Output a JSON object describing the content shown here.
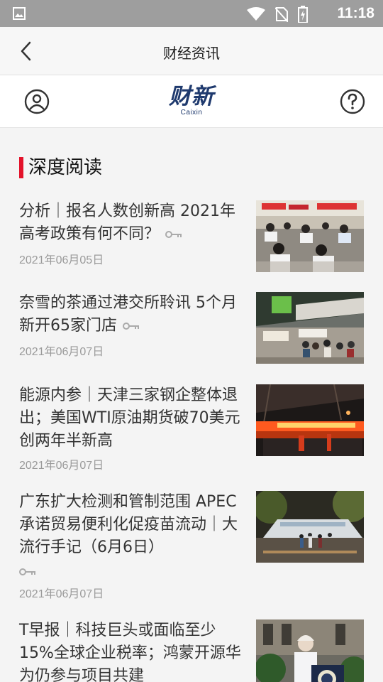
{
  "status_bar": {
    "time": "11:18"
  },
  "title_bar": {
    "title": "财经资讯"
  },
  "brand": {
    "logo_cn": "财新",
    "logo_en": "Caixin"
  },
  "section": {
    "title": "深度阅读"
  },
  "articles": [
    {
      "headline": "分析｜报名人数创新高 2021年高考政策有何不同？",
      "date": "2021年06月05日",
      "locked": true
    },
    {
      "headline": "奈雪的茶通过港交所聆讯 5个月新开65家门店",
      "date": "2021年06月07日",
      "locked": true
    },
    {
      "headline": "能源内参｜天津三家钢企整体退出；美国WTI原油期货破70美元 创两年半新高",
      "date": "2021年06月07日",
      "locked": false
    },
    {
      "headline": "广东扩大检测和管制范围 APEC承诺贸易便利化促疫苗流动｜大流行手记（6月6日）",
      "date": "2021年06月07日",
      "locked": true
    },
    {
      "headline": "T早报｜科技巨头或面临至少15%全球企业税率；鸿蒙开源华为仍参与项目共建",
      "date": "",
      "locked": false
    }
  ],
  "colors": {
    "accent": "#e3122a",
    "brand": "#1f3a6e",
    "status_bar": "#9e9e9e"
  },
  "icons": [
    "gallery-icon",
    "wifi-icon",
    "no-sim-icon",
    "battery-charging-icon",
    "back-icon",
    "user-icon",
    "help-icon",
    "key-icon"
  ]
}
